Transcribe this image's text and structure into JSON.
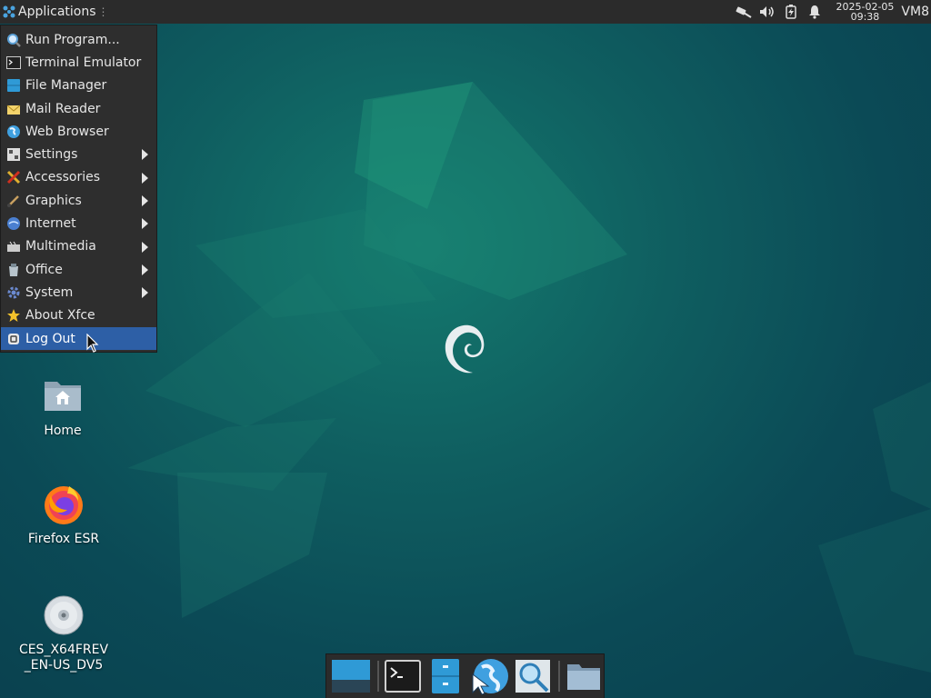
{
  "panel": {
    "apps_label": "Applications",
    "date": "2025-02-05",
    "time": "09:38",
    "user": "VM8",
    "tray_icons": [
      "network-wired-icon",
      "volume-icon",
      "battery-icon",
      "notification-bell-icon"
    ]
  },
  "menu": {
    "items": [
      {
        "label": "Run Program...",
        "icon": "run-program-icon",
        "submenu": false
      },
      {
        "label": "Terminal Emulator",
        "icon": "terminal-icon",
        "submenu": false
      },
      {
        "label": "File Manager",
        "icon": "file-manager-icon",
        "submenu": false
      },
      {
        "label": "Mail Reader",
        "icon": "mail-icon",
        "submenu": false
      },
      {
        "label": "Web Browser",
        "icon": "web-browser-icon",
        "submenu": false
      },
      {
        "label": "Settings",
        "icon": "settings-icon",
        "submenu": true
      },
      {
        "label": "Accessories",
        "icon": "accessories-icon",
        "submenu": true
      },
      {
        "label": "Graphics",
        "icon": "graphics-icon",
        "submenu": true
      },
      {
        "label": "Internet",
        "icon": "internet-icon",
        "submenu": true
      },
      {
        "label": "Multimedia",
        "icon": "multimedia-icon",
        "submenu": true
      },
      {
        "label": "Office",
        "icon": "office-icon",
        "submenu": true
      },
      {
        "label": "System",
        "icon": "system-icon",
        "submenu": true
      },
      {
        "label": "About Xfce",
        "icon": "star-icon",
        "submenu": false
      },
      {
        "label": "Log Out",
        "icon": "log-out-icon",
        "submenu": false
      }
    ],
    "highlighted": "Log Out"
  },
  "desktop": {
    "icons": [
      {
        "label": "Home",
        "icon": "home-folder-icon"
      },
      {
        "label": "Firefox ESR",
        "icon": "firefox-icon"
      },
      {
        "label": "CES_X64FREV\n_EN-US_DV5",
        "icon": "optical-disc-icon"
      }
    ]
  },
  "dock": {
    "items": [
      "show-desktop-icon",
      "terminal-icon",
      "file-manager-icon",
      "web-browser-icon",
      "app-finder-icon",
      "folder-icon"
    ]
  },
  "colors": {
    "panel_bg": "#2b2b2b",
    "menu_bg": "#2e2e2e",
    "menu_highlight": "#2d5fa6",
    "wallpaper_teal": "#0f5e60"
  }
}
